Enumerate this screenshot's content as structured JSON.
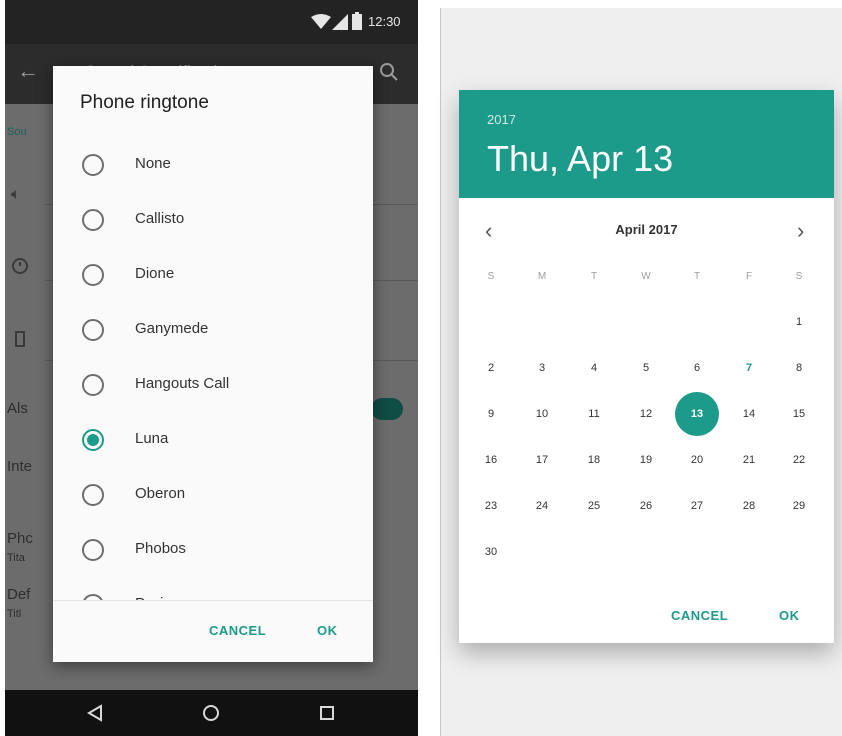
{
  "status_bar": {
    "time": "12:30"
  },
  "app_bar": {
    "title": "Sound & notification"
  },
  "settings_background": {
    "section_label": "Sou",
    "rows": [
      "Als",
      "Inte",
      "Phc",
      "Tita",
      "Def",
      "Titl"
    ]
  },
  "ringtone_dialog": {
    "title": "Phone ringtone",
    "items": [
      {
        "label": "None",
        "selected": false
      },
      {
        "label": "Callisto",
        "selected": false
      },
      {
        "label": "Dione",
        "selected": false
      },
      {
        "label": "Ganymede",
        "selected": false
      },
      {
        "label": "Hangouts Call",
        "selected": false
      },
      {
        "label": "Luna",
        "selected": true
      },
      {
        "label": "Oberon",
        "selected": false
      },
      {
        "label": "Phobos",
        "selected": false
      },
      {
        "label": "Pyxis",
        "selected": false
      }
    ],
    "cancel_label": "CANCEL",
    "ok_label": "OK"
  },
  "date_picker": {
    "year": "2017",
    "date_label": "Thu, Apr 13",
    "month_label": "April 2017",
    "weekdays": [
      "S",
      "M",
      "T",
      "W",
      "T",
      "F",
      "S"
    ],
    "days": [
      "1",
      "2",
      "3",
      "4",
      "5",
      "6",
      "7",
      "8",
      "9",
      "10",
      "11",
      "12",
      "13",
      "14",
      "15",
      "16",
      "17",
      "18",
      "19",
      "20",
      "21",
      "22",
      "23",
      "24",
      "25",
      "26",
      "27",
      "28",
      "29",
      "30"
    ],
    "today": "7",
    "selected": "13",
    "cancel_label": "CANCEL",
    "ok_label": "OK"
  },
  "colors": {
    "accent": "#1c9a8a",
    "dialog_bg": "#fafafa",
    "scrim": "#6c6c6c"
  }
}
